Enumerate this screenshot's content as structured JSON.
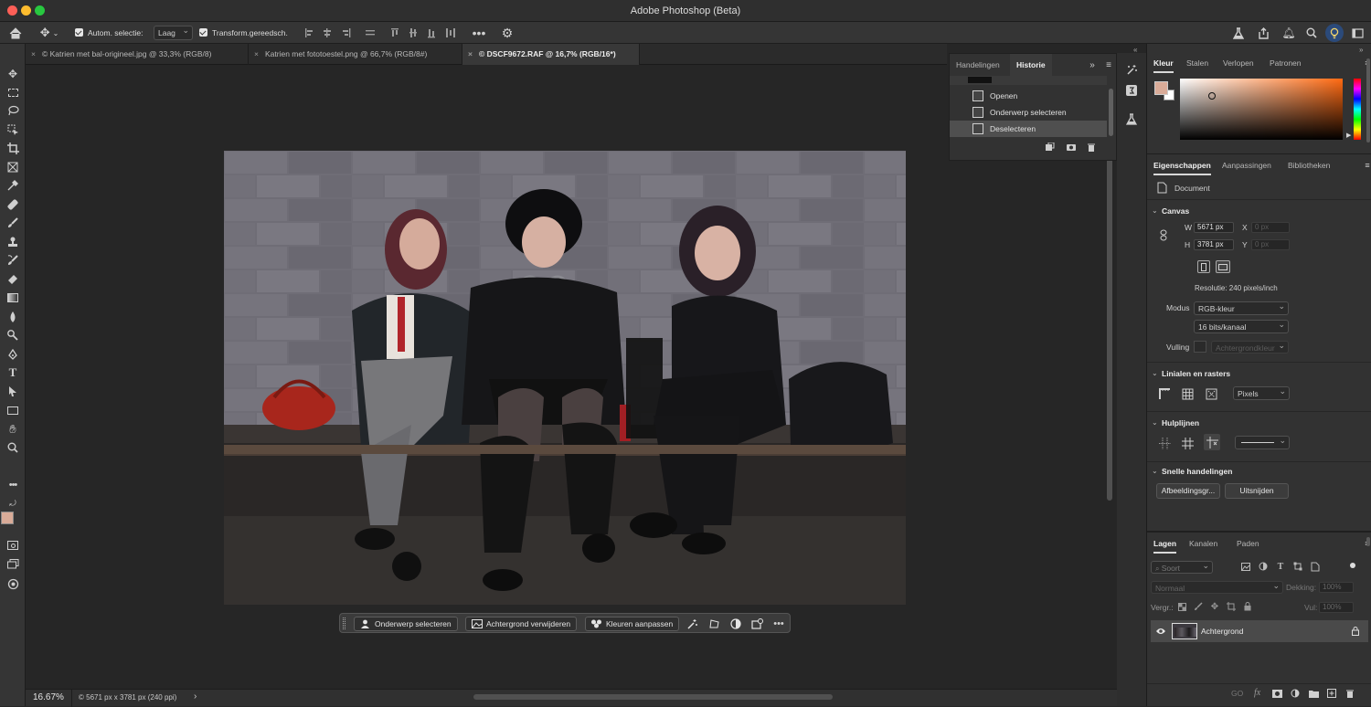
{
  "app": {
    "title": "Adobe Photoshop (Beta)"
  },
  "options": {
    "auto_select_label": "Autom. selectie:",
    "auto_select_value": "Laag",
    "transform_label": "Transform.gereedsch."
  },
  "doc_tabs": [
    {
      "label": "Katrien met bal-origineel.jpg @ 33,3% (RGB/8)"
    },
    {
      "label": "Katrien met fototoestel.png @ 66,7% (RGB/8#)"
    },
    {
      "label": "DSCF9672.RAF @ 16,7% (RGB/16*)"
    }
  ],
  "context_bar": {
    "select_subject": "Onderwerp selecteren",
    "remove_bg": "Achtergrond verwijderen",
    "adjust_colors": "Kleuren aanpassen"
  },
  "status": {
    "zoom": "16.67%",
    "info": "© 5671 px x 3781 px (240 ppi)",
    "arrow": "›"
  },
  "history_panel": {
    "tabs": [
      "Handelingen",
      "Historie"
    ],
    "items": [
      "Openen",
      "Onderwerp selecteren",
      "Deselecteren"
    ]
  },
  "color_panel": {
    "tabs": [
      "Kleur",
      "Stalen",
      "Verlopen",
      "Patronen"
    ],
    "fg_color": "#d9ab98",
    "bg_color": "#ffffff"
  },
  "properties": {
    "tabs": [
      "Eigenschappen",
      "Aanpassingen",
      "Bibliotheken"
    ],
    "doc_label": "Document",
    "canvas_title": "Canvas",
    "w_label": "W",
    "w_value": "5671 px",
    "h_label": "H",
    "h_value": "3781 px",
    "x_label": "X",
    "x_placeholder": "0 px",
    "y_label": "Y",
    "y_placeholder": "0 px",
    "resolution": "Resolutie: 240 pixels/inch",
    "mode_label": "Modus",
    "mode_value": "RGB-kleur",
    "depth_value": "16 bits/kanaal",
    "fill_label": "Vulling",
    "fill_value": "Achtergrondkleur",
    "rulers_title": "Linialen en rasters",
    "units_value": "Pixels",
    "guides_title": "Hulplijnen",
    "quick_title": "Snelle handelingen",
    "btn_image_size": "Afbeeldingsgr...",
    "btn_crop": "Uitsnijden"
  },
  "layers": {
    "tabs": [
      "Lagen",
      "Kanalen",
      "Paden"
    ],
    "search": "Soort",
    "blend": "Normaal",
    "opacity_label": "Dekking:",
    "opacity_value": "100%",
    "lock_label": "Vergr.:",
    "fill_label": "Vul:",
    "fill_value": "100%",
    "layer_name": "Achtergrond",
    "footer_link": "GO",
    "footer_fx": "fx"
  }
}
